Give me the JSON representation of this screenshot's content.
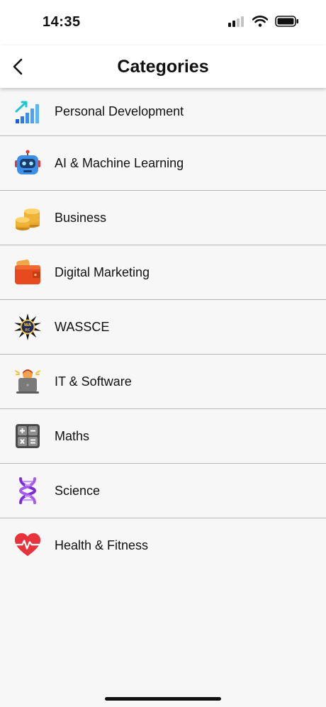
{
  "status_bar": {
    "time": "14:35"
  },
  "header": {
    "title": "Categories",
    "back_icon": "chevron-left-icon"
  },
  "categories": [
    {
      "label": "Personal Development",
      "icon": "growth-chart-icon"
    },
    {
      "label": "AI & Machine Learning",
      "icon": "robot-icon"
    },
    {
      "label": "Business",
      "icon": "coins-icon"
    },
    {
      "label": "Digital Marketing",
      "icon": "wallet-icon"
    },
    {
      "label": "WASSCE",
      "icon": "waec-badge-icon"
    },
    {
      "label": "IT & Software",
      "icon": "laptop-person-icon"
    },
    {
      "label": "Maths",
      "icon": "calculator-icon"
    },
    {
      "label": "Science",
      "icon": "dna-icon"
    },
    {
      "label": "Health & Fitness",
      "icon": "heartbeat-icon"
    }
  ],
  "colors": {
    "background": "#f7f7f7",
    "header": "#ffffff",
    "divider": "#b9b9b9",
    "text": "#111111"
  }
}
